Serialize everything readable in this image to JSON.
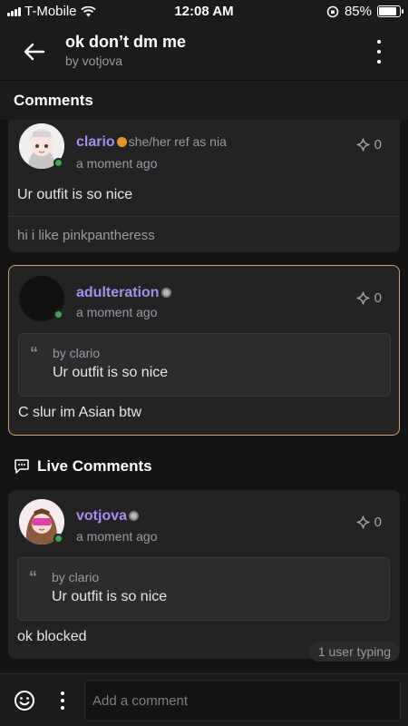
{
  "status_bar": {
    "carrier": "T-Mobile",
    "time": "12:08 AM",
    "battery": "85%",
    "battery_level": 0.85
  },
  "header": {
    "title": "ok don’t dm me",
    "subtitle": "by votjova"
  },
  "sections": {
    "comments_label": "Comments",
    "live_label": "Live Comments"
  },
  "comments": [
    {
      "username": "clario",
      "pronouns": "she/her ref as nia",
      "time": "a moment ago",
      "likes": "0",
      "text": "Ur outfit is so nice",
      "reply_preview": "hi i like pinkpantheress"
    },
    {
      "username": "adulteration",
      "time": "a moment ago",
      "likes": "0",
      "quote": {
        "by": "by clario",
        "text": "Ur outfit is so nice"
      },
      "text": "C slur im Asian btw"
    }
  ],
  "live_comments": [
    {
      "username": "votjova",
      "time": "a moment ago",
      "likes": "0",
      "quote": {
        "by": "by clario",
        "text": "Ur outfit is so nice"
      },
      "text": "ok blocked"
    }
  ],
  "typing_indicator": "1 user typing",
  "composer": {
    "placeholder": "Add a comment"
  },
  "colors": {
    "username": "#a98cf0",
    "highlight_border": "#c9a36a",
    "online": "#3ba55c"
  }
}
